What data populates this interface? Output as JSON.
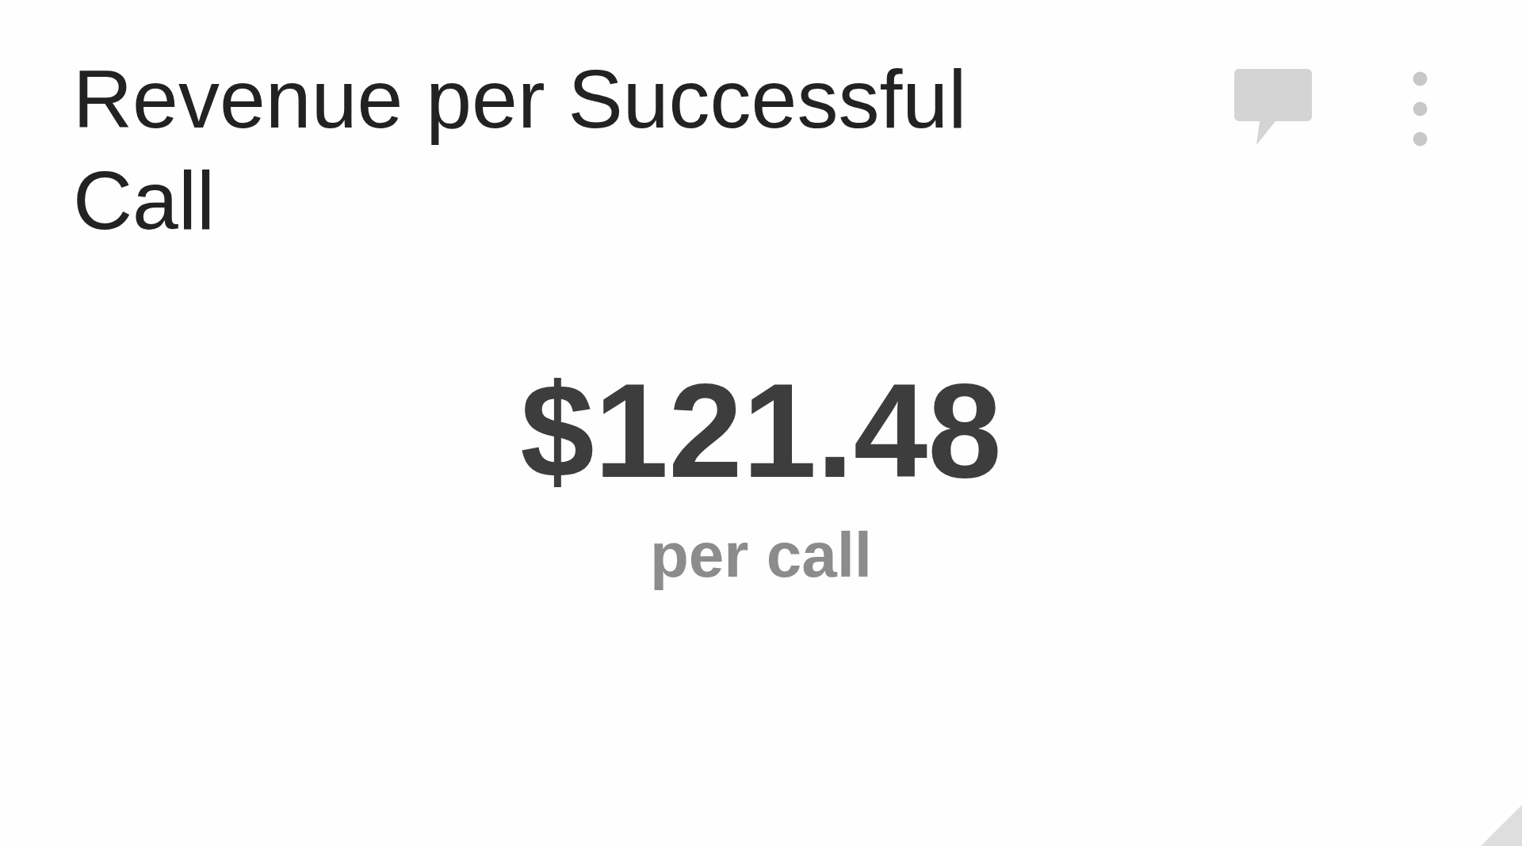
{
  "widget": {
    "title": "Revenue per Successful Call",
    "value": "$121.48",
    "caption": "per call"
  }
}
